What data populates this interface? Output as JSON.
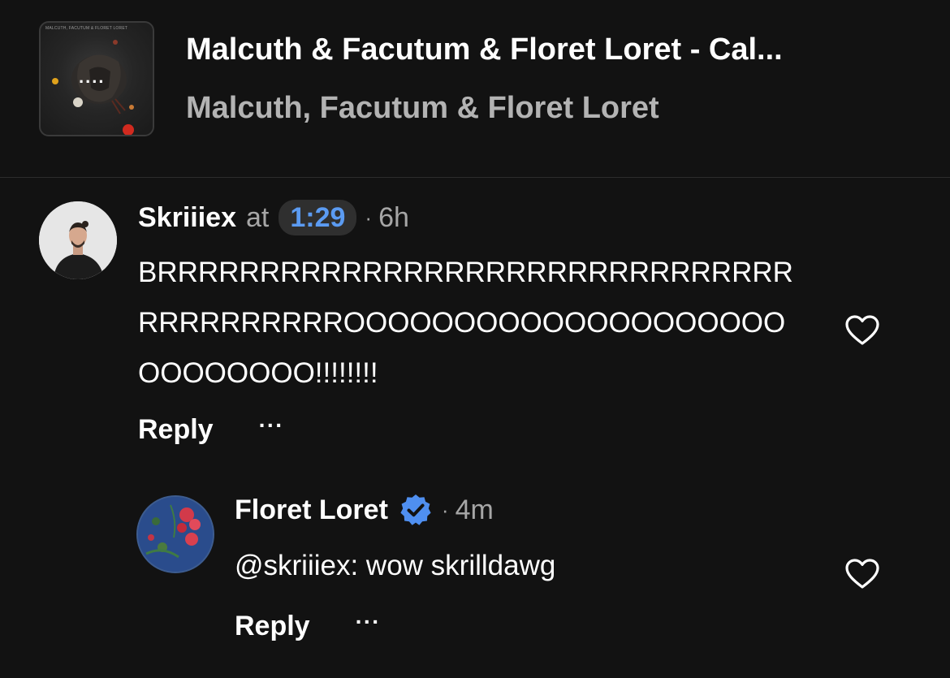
{
  "track": {
    "title": "Malcuth & Facutum & Floret Loret  - Cal...",
    "artists": "Malcuth, Facutum & Floret Loret",
    "artwork_caption": "MALCUTH, FACUTUM & FLORET LORET",
    "artwork_icon": "....",
    "border_color": "#2c2c2c"
  },
  "comments": [
    {
      "username": "Skriiiex",
      "at_label": "at",
      "timestamp": "1:29",
      "separator": "·",
      "age": "6h",
      "text": "BRRRRRRRRRRRRRRRRRRRRRRRRRRRRRRRRRRRRRRRRROOOOOOOOOOOOOOOOOOOOOOOOOOOO!!!!!!!!",
      "reply_label": "Reply",
      "more_label": "···",
      "verified": false
    },
    {
      "username": "Floret Loret",
      "separator": "·",
      "age": "4m",
      "text": "@skriiiex: wow skrilldawg",
      "reply_label": "Reply",
      "more_label": "···",
      "verified": true,
      "badge_icon": "verified-badge-icon"
    }
  ],
  "colors": {
    "background": "#121212",
    "timestamp_accent": "#5b9bf2",
    "verified_blue": "#4f8ff0",
    "secondary_text": "#a6a6a6"
  }
}
